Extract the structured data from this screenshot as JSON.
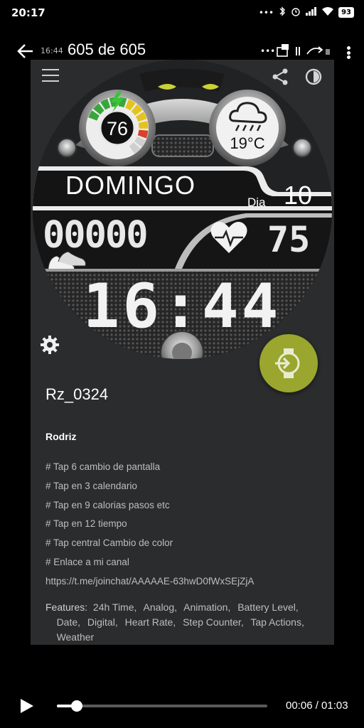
{
  "status_bar": {
    "time": "20:17",
    "battery": "93",
    "icons": [
      "more-icon",
      "bluetooth-icon",
      "alarm-icon",
      "signal-icon",
      "wifi-icon",
      "battery-icon"
    ]
  },
  "viewer": {
    "small_time": "16:44",
    "title": "605 de 605"
  },
  "watch_face": {
    "battery_level": "76",
    "temperature": "19°C",
    "day_name": "DOMINGO",
    "day_label": "Dia",
    "day_number": "10",
    "steps": "00000",
    "heart_rate": "75",
    "time": "16:44",
    "battery_gauge_fraction": 0.76,
    "colors": {
      "accent": "#9aa62e",
      "gauge_green": "#3aa63a",
      "gauge_yellow": "#e6c21e",
      "gauge_red": "#d8412b"
    }
  },
  "details": {
    "name": "Rz_0324",
    "author": "Rodriz",
    "description": [
      "# Tap 6 cambio de pantalla",
      "# Tap en 3 calendario",
      "# Tap en 9 calorias pasos etc",
      "# Tap en 12 tiempo",
      "# Tap central Cambio de color",
      "# Enlace a mi canal",
      "https://t.me/joinchat/AAAAAE-63hwD0fWxSEjZjA"
    ],
    "features_label": "Features:",
    "features": [
      "24h Time,",
      "Analog,",
      "Animation,",
      "Battery Level,",
      "Date,",
      "Digital,",
      "Heart Rate,",
      "Step Counter,",
      "Tap Actions,",
      "Weather"
    ]
  },
  "player": {
    "time_readout": "00:06 / 01:03",
    "progress_fraction": 0.095
  }
}
